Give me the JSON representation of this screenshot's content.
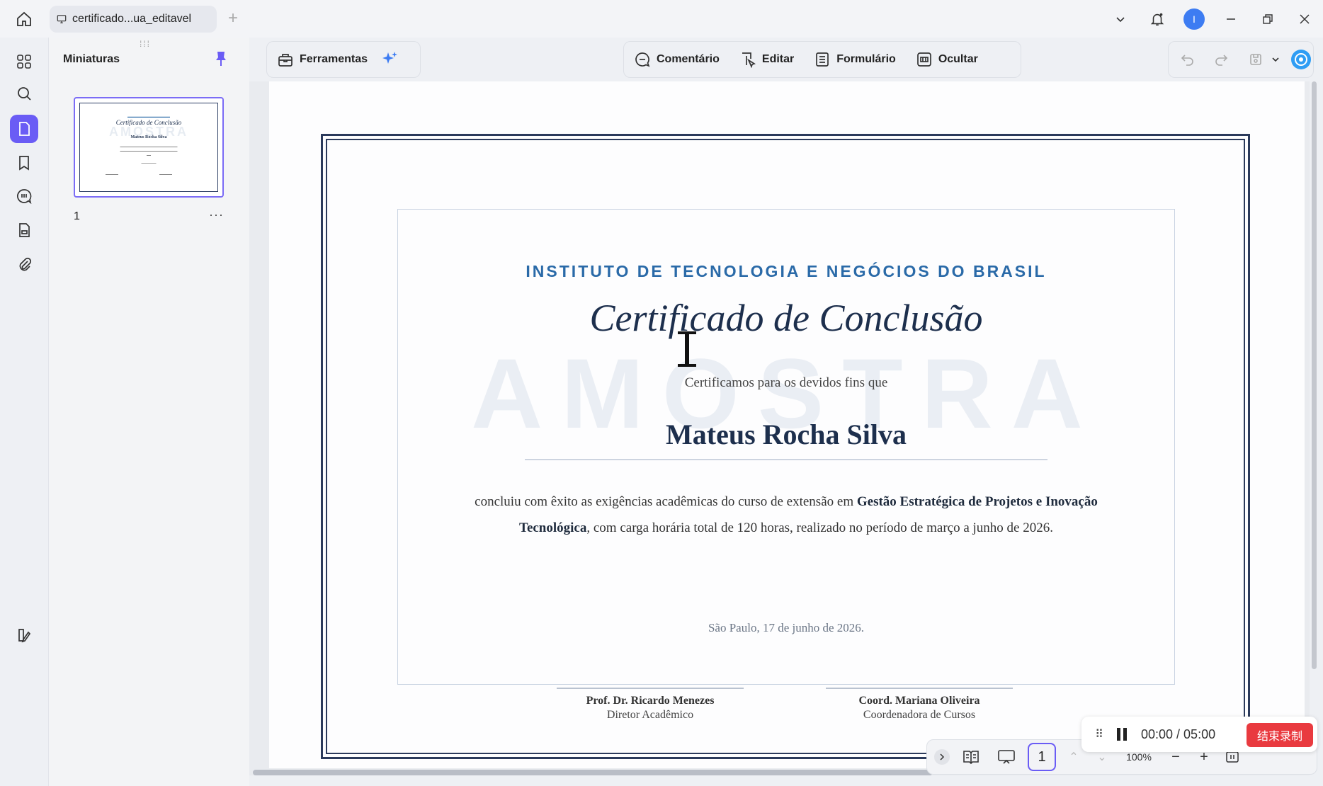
{
  "tab": {
    "title": "certificado...ua_editavel"
  },
  "window": {
    "avatar_letter": "I"
  },
  "sidebar": {
    "title": "Miniaturas",
    "thumbnail_page": "1"
  },
  "toolbar": {
    "tools_label": "Ferramentas",
    "comment_label": "Comentário",
    "edit_label": "Editar",
    "form_label": "Formulário",
    "hide_label": "Ocultar"
  },
  "certificate": {
    "institute": "INSTITUTO DE TECNOLOGIA E NEGÓCIOS DO BRASIL",
    "title": "Certificado de Conclusão",
    "watermark": "AMOSTRA",
    "intro": "Certificamos para os devidos fins que",
    "recipient": "Mateus Rocha Silva",
    "body_part1": "concluiu com êxito as exigências acadêmicas do curso de extensão em ",
    "course": "Gestão Estratégica de Projetos e Inovação Tecnológica",
    "body_part2": ", com carga horária total de 120 horas, realizado no período de março a junho de 2026.",
    "date": "São Paulo, 17 de junho de 2026.",
    "signatures": [
      {
        "name": "Prof. Dr. Ricardo Menezes",
        "role": "Diretor Acadêmico"
      },
      {
        "name": "Coord. Mariana Oliveira",
        "role": "Coordenadora de Cursos"
      }
    ]
  },
  "bottom": {
    "page_number": "1",
    "zoom": "100%"
  },
  "recording": {
    "time": "00:00 / 05:00",
    "stop_label": "结束录制"
  },
  "colors": {
    "accent": "#6a5cf5",
    "institute": "#2a6aa8",
    "title": "#1d2f4d",
    "record": "#e93a3f"
  }
}
